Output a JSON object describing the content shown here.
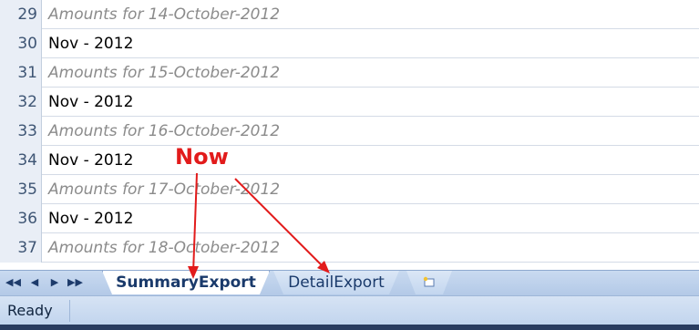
{
  "rows": [
    {
      "num": "29",
      "text": "Amounts for 14-October-2012",
      "italic": true
    },
    {
      "num": "30",
      "text": "Nov - 2012",
      "italic": false
    },
    {
      "num": "31",
      "text": "Amounts for 15-October-2012",
      "italic": true
    },
    {
      "num": "32",
      "text": "Nov - 2012",
      "italic": false
    },
    {
      "num": "33",
      "text": "Amounts for 16-October-2012",
      "italic": true
    },
    {
      "num": "34",
      "text": "Nov - 2012",
      "italic": false
    },
    {
      "num": "35",
      "text": "Amounts for 17-October-2012",
      "italic": true
    },
    {
      "num": "36",
      "text": "Nov - 2012",
      "italic": false
    },
    {
      "num": "37",
      "text": "Amounts for 18-October-2012",
      "italic": true
    }
  ],
  "sheet_tabs": {
    "active": "SummaryExport",
    "inactive": "DetailExport",
    "new_sheet_icon": "insert-worksheet-icon"
  },
  "nav_buttons": [
    "first-sheet-icon",
    "prev-sheet-icon",
    "next-sheet-icon",
    "last-sheet-icon"
  ],
  "status": {
    "text": "Ready"
  },
  "annotation": {
    "label": "Now",
    "color": "#e21b1b"
  }
}
